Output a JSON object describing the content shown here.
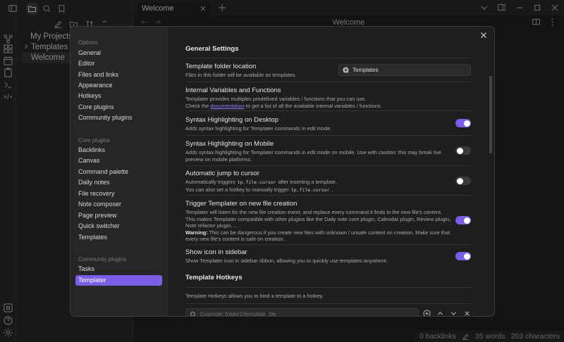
{
  "vault": {
    "items": [
      {
        "label": "My Projects"
      },
      {
        "label": "Templates"
      },
      {
        "label": "Welcome"
      }
    ]
  },
  "tabs": {
    "active_label": "Welcome"
  },
  "editor": {
    "title": "Welcome"
  },
  "statusbar": {
    "backlinks": "0 backlinks",
    "words": "35 words",
    "characters": "203 characters"
  },
  "settings": {
    "sidebar": {
      "options_header": "Options",
      "options": [
        "General",
        "Editor",
        "Files and links",
        "Appearance",
        "Hotkeys",
        "Core plugins",
        "Community plugins"
      ],
      "core_header": "Core plugins",
      "core": [
        "Backlinks",
        "Canvas",
        "Command palette",
        "Daily notes",
        "File recovery",
        "Note composer",
        "Page preview",
        "Quick switcher",
        "Templates"
      ],
      "community_header": "Community plugins",
      "community": [
        "Tasks",
        "Templater"
      ]
    },
    "general_title": "General Settings",
    "folder": {
      "name": "Template folder location",
      "desc": "Files in this folder will be available as templates.",
      "value": "Templates"
    },
    "internal": {
      "name": "Internal Variables and Functions",
      "desc1": "Templater provides multiples predefined variables / functions that you can use.",
      "desc2_pre": "Check the",
      "desc2_link": "documentation",
      "desc2_post": "to get a list of all the available internal variables / functions."
    },
    "syntax_desktop": {
      "name": "Syntax Highlighting on Desktop",
      "desc": "Adds syntax highlighting for Templater commands in edit mode.",
      "on": true
    },
    "syntax_mobile": {
      "name": "Syntax Highlighting on Mobile",
      "desc": "Adds syntax highlighting for Templater commands in edit mode on mobile. Use with caution: this may break live preview on mobile platforms.",
      "on": false
    },
    "jump": {
      "name": "Automatic jump to cursor",
      "desc1_pre": "Automatically triggers",
      "desc1_code": "tp.file.cursor",
      "desc1_post": "after inserting a template.",
      "desc2_pre": "You can also set a hotkey to manually trigger",
      "desc2_code": "tp.file.cursor",
      "desc2_post": ".",
      "on": false
    },
    "trigger": {
      "name": "Trigger Templater on new file creation",
      "desc1": "Templater will listen for the new file creation event, and replace every command it finds in the new file's content.",
      "desc2": "This makes Templater compatible with other plugins like the Daily note core plugin, Calendar plugin, Review plugin, Note refactor plugin, ...",
      "warning_label": "Warning:",
      "warning_text": "This can be dangerous if you create new files with unknown / unsafe content on creation. Make sure that every new file's content is safe on creation.",
      "on": true
    },
    "ribbon": {
      "name": "Show icon in sidebar",
      "desc": "Show Templater icon in sidebar ribbon, allowing you to quickly use templates anywhere.",
      "on": true
    },
    "hotkeys_title": "Template Hotkeys",
    "hotkeys_desc": "Template Hotkeys allows you to bind a template to a hotkey.",
    "hotkey_placeholder": "Example: folder1/template_file"
  },
  "colors": {
    "accent": "#7c5de6",
    "background": "#1e1e1e",
    "panel": "#262626"
  }
}
